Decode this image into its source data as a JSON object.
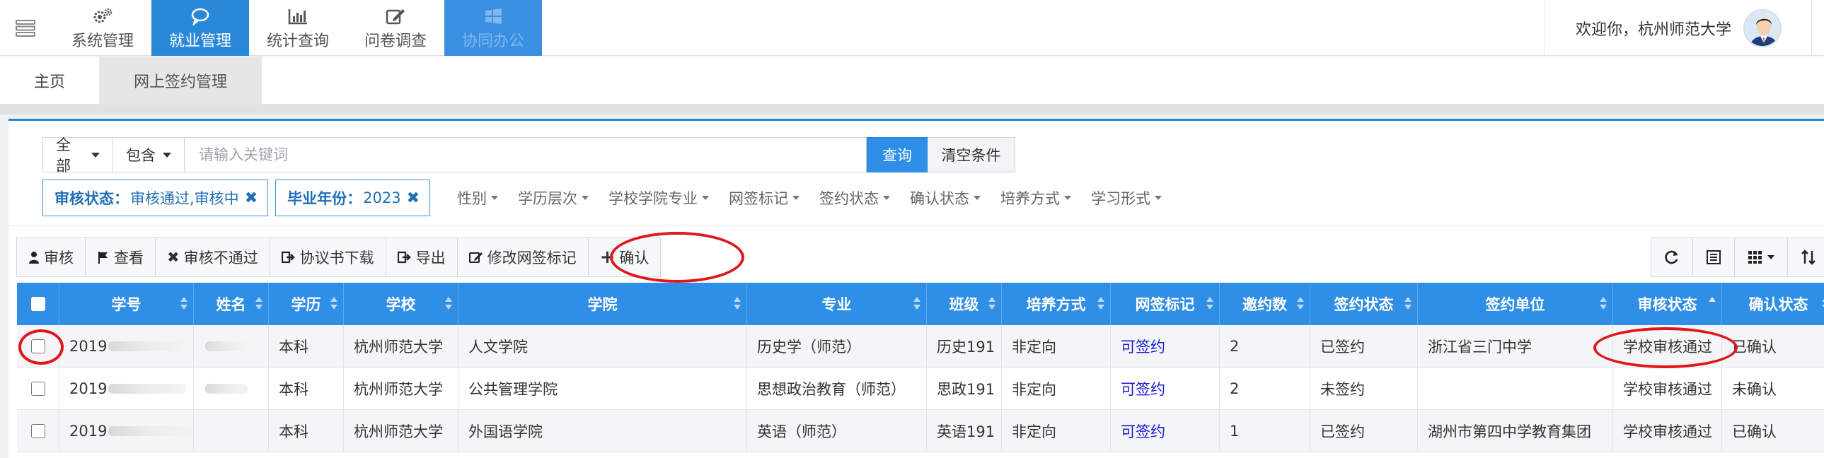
{
  "nav": {
    "items": [
      {
        "label": "系统管理",
        "icon": "gear-icon"
      },
      {
        "label": "就业管理",
        "icon": "chat-bubble-icon"
      },
      {
        "label": "统计查询",
        "icon": "bar-chart-icon"
      },
      {
        "label": "问卷调查",
        "icon": "edit-icon"
      },
      {
        "label": "协同办公",
        "icon": "windows-icon"
      }
    ],
    "active_index": 1
  },
  "user": {
    "welcome": "欢迎你，杭州师范大学"
  },
  "tabs": [
    {
      "label": "主页"
    },
    {
      "label": "网上签约管理"
    }
  ],
  "search": {
    "scope": "全部",
    "match": "包含",
    "placeholder": "请输入关键词",
    "query_label": "查询",
    "clear_label": "清空条件"
  },
  "active_filters": [
    {
      "key": "审核状态：",
      "value": "审核通过,审核中"
    },
    {
      "key": "毕业年份：",
      "value": "2023"
    }
  ],
  "filter_dropdowns": [
    "性别",
    "学历层次",
    "学校学院专业",
    "网签标记",
    "签约状态",
    "确认状态",
    "培养方式",
    "学习形式"
  ],
  "toolbar": {
    "buttons": [
      {
        "label": "审核",
        "icon": "user-icon"
      },
      {
        "label": "查看",
        "icon": "flag-icon"
      },
      {
        "label": "审核不通过",
        "icon": "close-icon"
      },
      {
        "label": "协议书下载",
        "icon": "download-icon"
      },
      {
        "label": "导出",
        "icon": "export-icon"
      },
      {
        "label": "修改网签标记",
        "icon": "edit-icon"
      },
      {
        "label": "确认",
        "icon": "plus-icon"
      }
    ],
    "right_icons": [
      "refresh-icon",
      "list-icon",
      "grid-icon",
      "sort-icon"
    ]
  },
  "table": {
    "columns": [
      "学号",
      "姓名",
      "学历",
      "学校",
      "学院",
      "专业",
      "班级",
      "培养方式",
      "网签标记",
      "邀约数",
      "签约状态",
      "签约单位",
      "审核状态",
      "确认状态"
    ],
    "rows": [
      {
        "student_id": "2019",
        "name": "",
        "degree": "本科",
        "school": "杭州师范大学",
        "college": "人文学院",
        "major": "历史学（师范）",
        "class": "历史191",
        "training": "非定向",
        "sign_mark": "可签约",
        "invites": "2",
        "sign_status": "已签约",
        "employer": "浙江省三门中学",
        "review_status": "学校审核通过",
        "confirm_status": "已确认"
      },
      {
        "student_id": "2019",
        "name": "",
        "degree": "本科",
        "school": "杭州师范大学",
        "college": "公共管理学院",
        "major": "思想政治教育（师范）",
        "class": "思政191",
        "training": "非定向",
        "sign_mark": "可签约",
        "invites": "2",
        "sign_status": "未签约",
        "employer": "",
        "review_status": "学校审核通过",
        "confirm_status": "未确认"
      },
      {
        "student_id": "2019",
        "name": "",
        "degree": "本科",
        "school": "杭州师范大学",
        "college": "外国语学院",
        "major": "英语（师范）",
        "class": "英语191",
        "training": "非定向",
        "sign_mark": "可签约",
        "invites": "1",
        "sign_status": "已签约",
        "employer": "湖州市第四中学教育集团",
        "review_status": "学校审核通过",
        "confirm_status": "已确认"
      }
    ]
  },
  "colors": {
    "primary": "#2f8ee5",
    "nav_active": "#2a88d8",
    "annotation": "#e0161c",
    "link": "#1a1ad6"
  }
}
